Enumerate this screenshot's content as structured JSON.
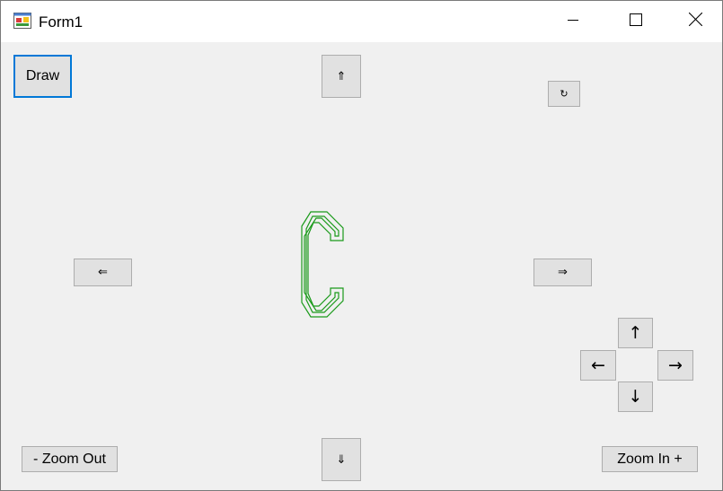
{
  "window": {
    "title": "Form1"
  },
  "buttons": {
    "draw": "Draw",
    "pan_up": "⇑",
    "pan_down": "⇓",
    "pan_left": "⇐",
    "pan_right": "⇒",
    "rotate": "↻",
    "move_up": "↑",
    "move_down": "↓",
    "move_left": "←",
    "move_right": "→",
    "zoom_out": "- Zoom Out",
    "zoom_in": "Zoom In +"
  },
  "icons": {
    "app": "form-app-icon",
    "minimize": "minimize-icon",
    "maximize": "maximize-icon",
    "close": "close-icon"
  },
  "colors": {
    "shape_stroke": "#1a9a1a",
    "focus_border": "#0078d7",
    "button_face": "#e1e1e1",
    "client_bg": "#f0f0f0"
  }
}
